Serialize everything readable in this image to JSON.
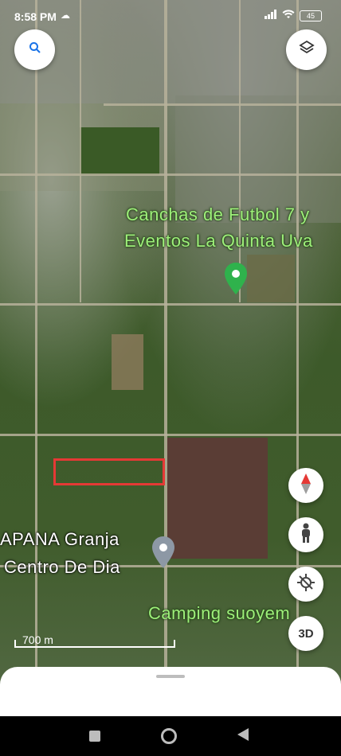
{
  "status_bar": {
    "time": "8:58 PM",
    "battery": "45",
    "icons": [
      "cloud-icon",
      "signal-icon",
      "wifi-icon",
      "battery-icon"
    ]
  },
  "map": {
    "places": [
      {
        "line1": "Canchas de Futbol 7 y",
        "line2": "Eventos La Quinta Uva",
        "pin": "green-place-pin-icon"
      },
      {
        "line1": "APANA Granja",
        "line2": "Centro De Dia",
        "pin": "gray-place-pin-icon"
      },
      {
        "line1": "Camping suoyem"
      }
    ],
    "scale_label": "700 m",
    "highlight_color": "#e53935",
    "pin_colors": {
      "green": "#2fb24c",
      "gray": "#8d98a5"
    }
  },
  "controls": {
    "search_icon": "search-icon",
    "layers_icon": "layers-icon",
    "compass_icon": "compass-icon",
    "street_view_icon": "pegman-icon",
    "location_icon": "location-off-icon",
    "view_3d_label": "3D"
  },
  "navbar": {
    "buttons": [
      "recent-apps-icon",
      "home-icon",
      "back-icon"
    ]
  }
}
